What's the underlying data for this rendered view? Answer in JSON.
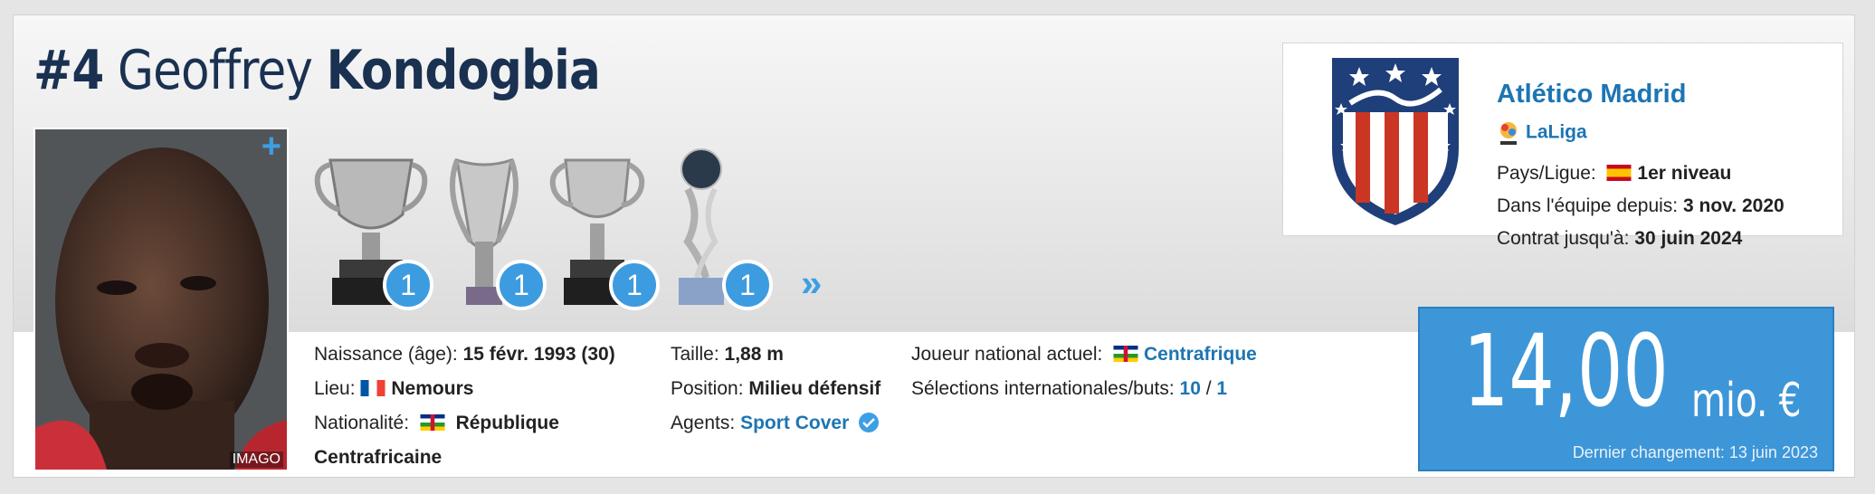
{
  "player": {
    "number": "#4",
    "first_name": "Geoffrey",
    "last_name": "Kondogbia",
    "photo_credit": "IMAGO",
    "photo_more": "+"
  },
  "trophies": [
    {
      "icon": "laliga-trophy-icon",
      "count": "1"
    },
    {
      "icon": "europa-league-trophy-icon",
      "count": "1"
    },
    {
      "icon": "supercup-trophy-icon",
      "count": "1"
    },
    {
      "icon": "uefa-super-cup-trophy-icon",
      "count": "1"
    }
  ],
  "trophies_more": "»",
  "info": {
    "birth_label": "Naissance (âge):",
    "birth_value": "15 févr. 1993 (30)",
    "place_label": "Lieu:",
    "place_value": "Nemours",
    "nationality_label": "Nationalité:",
    "nationality_value_1": "République",
    "nationality_value_2": "Centrafricaine",
    "height_label": "Taille:",
    "height_value": "1,88 m",
    "position_label": "Position:",
    "position_value": "Milieu défensif",
    "agents_label": "Agents:",
    "agents_value": "Sport Cover",
    "national_label": "Joueur national actuel:",
    "national_value": "Centrafrique",
    "caps_label": "Sélections internationales/buts:",
    "caps_value": "10",
    "caps_sep": "/",
    "goals_value": "1"
  },
  "club": {
    "name": "Atlético Madrid",
    "league": "LaLiga",
    "country_label": "Pays/Ligue:",
    "country_value": "1er niveau",
    "joined_label": "Dans l'équipe depuis:",
    "joined_value": "3 nov. 2020",
    "contract_label": "Contrat jusqu'à:",
    "contract_value": "30 juin 2024"
  },
  "market_value": {
    "amount": "14,00",
    "unit": "mio. €",
    "last_change": "Dernier changement: 13 juin 2023"
  },
  "colors": {
    "link": "#1d75b3",
    "title": "#1a3151",
    "value_box": "#3d96d8",
    "badge": "#3d9be0"
  }
}
